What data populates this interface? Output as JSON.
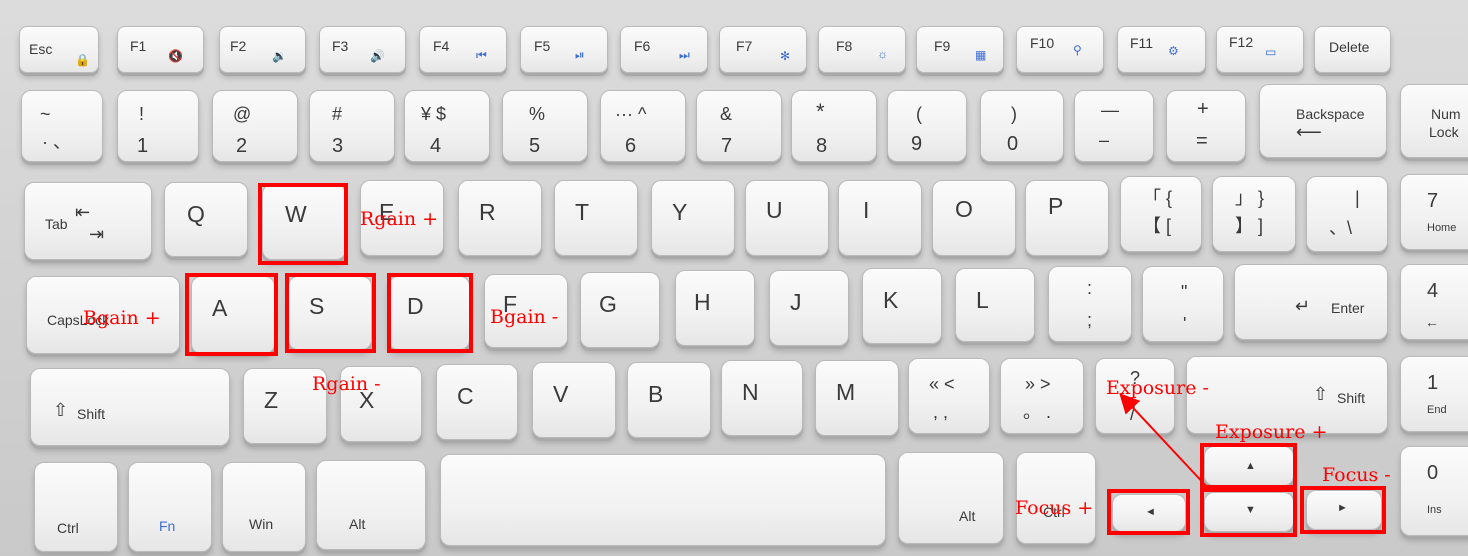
{
  "function_row": {
    "esc": "Esc",
    "f1": "F1",
    "f2": "F2",
    "f3": "F3",
    "f4": "F4",
    "f5": "F5",
    "f6": "F6",
    "f7": "F7",
    "f8": "F8",
    "f9": "F9",
    "f10": "F10",
    "f11": "F11",
    "f12": "F12",
    "delete": "Delete",
    "icons": [
      "lock-icon",
      "mute-icon",
      "volume-down-icon",
      "volume-up-icon",
      "previous-track-icon",
      "play-pause-icon",
      "next-track-icon",
      "brightness-down-icon",
      "brightness-up-icon",
      "calculator-icon",
      "search-icon",
      "settings-icon",
      "display-icon"
    ]
  },
  "number_row": {
    "grave": {
      "top": "~",
      "bottom": "· 、"
    },
    "k1": {
      "top": "!",
      "bottom": "1"
    },
    "k2": {
      "top": "@",
      "bottom": "2"
    },
    "k3": {
      "top": "#",
      "bottom": "3"
    },
    "k4": {
      "top": "¥ $",
      "bottom": "4"
    },
    "k5": {
      "top": "%",
      "bottom": "5"
    },
    "k6": {
      "top": "··· ^",
      "bottom": "6"
    },
    "k7": {
      "top": "&",
      "bottom": "7"
    },
    "k8": {
      "top": "*",
      "bottom": "8"
    },
    "k9": {
      "top": "(",
      "bottom": "9"
    },
    "k0": {
      "top": ")",
      "bottom": "0"
    },
    "minus": {
      "top": "—",
      "bottom": "–"
    },
    "equal": {
      "top": "+",
      "bottom": "="
    },
    "backspace": "Backspace",
    "numlock": {
      "top": "Num",
      "bottom": "Lock"
    }
  },
  "qwerty_row": {
    "tab": "Tab",
    "letters": [
      "Q",
      "W",
      "E",
      "R",
      "T",
      "Y",
      "U",
      "I",
      "O",
      "P"
    ],
    "lbracket": {
      "top": "「 {",
      "bottom": "【 ["
    },
    "rbracket": {
      "top": "」 }",
      "bottom": "】 ]"
    },
    "backslash": {
      "top": "|",
      "bottom": "、\\"
    },
    "num7": {
      "top": "7",
      "bottom": "Home"
    }
  },
  "home_row": {
    "caps": "CapsLock",
    "letters": [
      "A",
      "S",
      "D",
      "F",
      "G",
      "H",
      "J",
      "K",
      "L"
    ],
    "semicolon": {
      "top": ":",
      "bottom": ";"
    },
    "quote": {
      "top": "\"",
      "bottom": "'"
    },
    "enter": "Enter",
    "num4": {
      "top": "4",
      "bottom": "←"
    }
  },
  "shift_row": {
    "lshift": "Shift",
    "letters": [
      "Z",
      "X",
      "C",
      "V",
      "B",
      "N",
      "M"
    ],
    "comma": {
      "top": "« <",
      "bottom": ", ,"
    },
    "period": {
      "top": "» >",
      "bottom": "。 ."
    },
    "slash": {
      "top": "?",
      "bottom": "/"
    },
    "rshift": "Shift",
    "num1": {
      "top": "1",
      "bottom": "End"
    }
  },
  "bottom_row": {
    "ctrl": "Ctrl",
    "fn": "Fn",
    "win": "Win",
    "alt": "Alt",
    "ralt": "Alt",
    "rctrl": "Ctrl",
    "left": "◄",
    "up": "▲",
    "down": "▼",
    "right": "►",
    "num0": {
      "top": "0",
      "bottom": "Ins"
    }
  },
  "annotations": {
    "rgain_plus": "Rgain +",
    "rgain_minus": "Rgain -",
    "bgain_plus": "Bgain +",
    "bgain_minus": "Bgain -",
    "exposure_minus": "Exposure -",
    "exposure_plus": "Exposure +",
    "focus_plus": "Focus +",
    "focus_minus": "Focus -",
    "color": "#ff0000"
  }
}
